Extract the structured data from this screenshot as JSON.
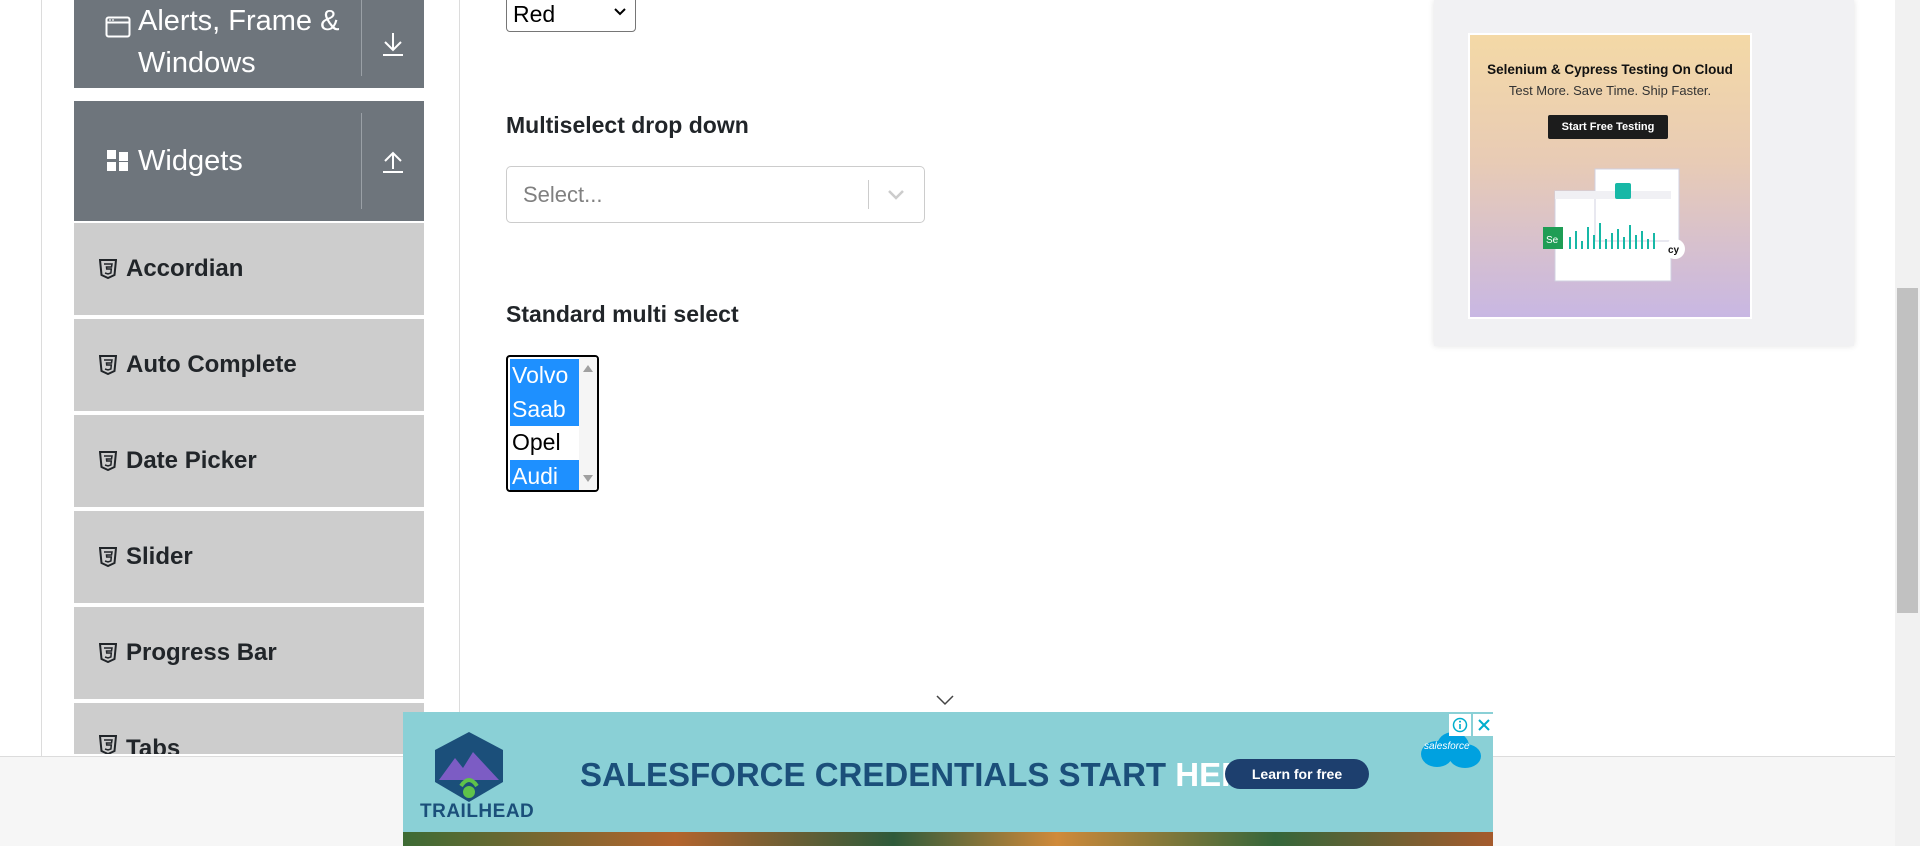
{
  "nav": {
    "groups": [
      {
        "label_line1": "Alerts, Frame &",
        "label_line2": "Windows",
        "icon": "window-icon",
        "toggle_icon": "download-arrow-icon"
      },
      {
        "label": "Widgets",
        "icon": "widgets-icon",
        "toggle_icon": "upload-arrow-icon"
      }
    ],
    "items": [
      {
        "label": "Accordian",
        "icon": "html5-icon"
      },
      {
        "label": "Auto Complete",
        "icon": "html5-icon"
      },
      {
        "label": "Date Picker",
        "icon": "html5-icon"
      },
      {
        "label": "Slider",
        "icon": "html5-icon"
      },
      {
        "label": "Progress Bar",
        "icon": "html5-icon"
      },
      {
        "label": "Tabs",
        "icon": "html5-icon"
      }
    ]
  },
  "main": {
    "color_select": {
      "value": "Red"
    },
    "multiselect": {
      "label": "Multiselect drop down",
      "placeholder": "Select..."
    },
    "standard_multi": {
      "label": "Standard multi select",
      "options": [
        {
          "label": "Volvo",
          "selected": true
        },
        {
          "label": "Saab",
          "selected": true
        },
        {
          "label": "Opel",
          "selected": false
        },
        {
          "label": "Audi",
          "selected": true
        }
      ]
    }
  },
  "side_ad": {
    "title": "Selenium & Cypress Testing On Cloud",
    "subtitle": "Test More. Save Time. Ship Faster.",
    "button": "Start Free Testing"
  },
  "bottom_ad": {
    "brand": "TRAILHEAD",
    "headline_main": "SALESFORCE CREDENTIALS START ",
    "headline_highlight": "HERE.",
    "cta": "Learn for free",
    "sponsor": "salesforce"
  },
  "colors": {
    "nav_header_bg": "#6e757c",
    "nav_item_bg": "#cdcdcd",
    "selected_option_bg": "#1e90ff",
    "banner_bg": "#8ad0d6",
    "banner_cta_bg": "#1d3f6e"
  }
}
